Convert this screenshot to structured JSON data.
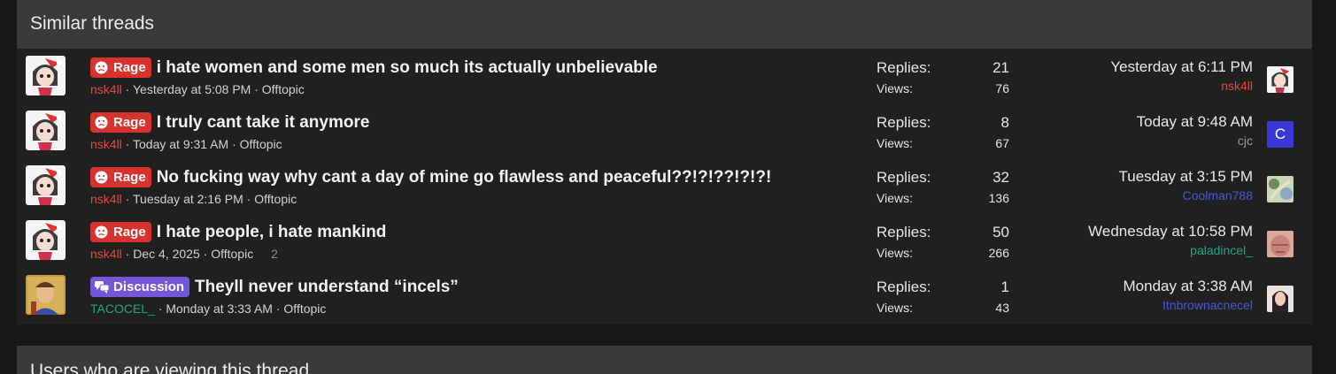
{
  "section_title": "Similar threads",
  "footer_title": "Users who are viewing this thread",
  "stat_labels": {
    "replies": "Replies:",
    "views": "Views:"
  },
  "colors": {
    "rage": "#d8322f",
    "discussion": "#7357d9",
    "user_red": "#e04848",
    "user_green": "#21a580",
    "user_blue": "#4d55d6",
    "user_gray": "#9a9a9a"
  },
  "threads": [
    {
      "prefix": "Rage",
      "prefix_icon": "sad-face-icon",
      "title": "i hate women and some men so much its actually unbelievable",
      "author": "nsk4ll",
      "started": "Yesterday at 5:08 PM",
      "forum": "Offtopic",
      "pages": "",
      "replies": "21",
      "views": "76",
      "last_time": "Yesterday at 6:11 PM",
      "last_user": "nsk4ll",
      "last_avatar": "anime-girl-avatar"
    },
    {
      "prefix": "Rage",
      "prefix_icon": "sad-face-icon",
      "title": "I truly cant take it anymore",
      "author": "nsk4ll",
      "started": "Today at 9:31 AM",
      "forum": "Offtopic",
      "pages": "",
      "replies": "8",
      "views": "67",
      "last_time": "Today at 9:48 AM",
      "last_user": "cjc",
      "last_avatar": "letter-avatar",
      "last_avatar_letter": "C"
    },
    {
      "prefix": "Rage",
      "prefix_icon": "sad-face-icon",
      "title": "No fucking way why cant a day of mine go flawless and peaceful??!?!??!?!?!",
      "author": "nsk4ll",
      "started": "Tuesday at 2:16 PM",
      "forum": "Offtopic",
      "pages": "",
      "replies": "32",
      "views": "136",
      "last_time": "Tuesday at 3:15 PM",
      "last_user": "Coolman788",
      "last_avatar": "pattern-avatar"
    },
    {
      "prefix": "Rage",
      "prefix_icon": "sad-face-icon",
      "title": "I hate people, i hate mankind",
      "author": "nsk4ll",
      "started": "Dec 4, 2025",
      "forum": "Offtopic",
      "pages": "2",
      "replies": "50",
      "views": "266",
      "last_time": "Wednesday at 10:58 PM",
      "last_user": "paladincel_",
      "last_avatar": "face-avatar"
    },
    {
      "prefix": "Discussion",
      "prefix_icon": "chat-bubbles-icon",
      "title": "Theyll never understand “incels”",
      "author": "TACOCEL_",
      "started": "Monday at 3:33 AM",
      "forum": "Offtopic",
      "pages": "",
      "replies": "1",
      "views": "43",
      "last_time": "Monday at 3:38 AM",
      "last_user": "Itnbrownacnecel",
      "last_avatar": "photo-avatar"
    }
  ]
}
